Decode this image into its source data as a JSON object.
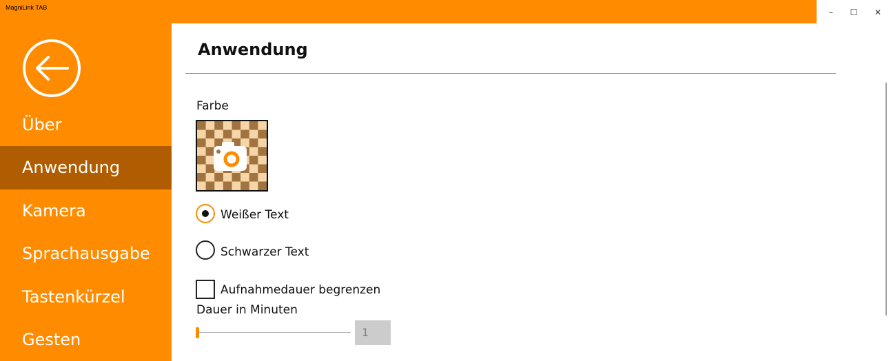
{
  "window": {
    "title": "MagniLink TAB",
    "minimize": "–",
    "maximize": "☐",
    "close": "✕"
  },
  "sidebar": {
    "items": [
      {
        "label": "Über"
      },
      {
        "label": "Anwendung"
      },
      {
        "label": "Kamera"
      },
      {
        "label": "Sprachausgabe"
      },
      {
        "label": "Tastenkürzel"
      },
      {
        "label": "Gesten"
      }
    ]
  },
  "main": {
    "title": "Anwendung",
    "color_label": "Farbe",
    "radio_white": "Weißer Text",
    "radio_black": "Schwarzer Text",
    "checkbox_limit": "Aufnahmedauer begrenzen",
    "duration_label": "Dauer in Minuten",
    "duration_value": "1",
    "duration_level": 0
  },
  "colors": {
    "accent": "#ff8c00",
    "nav_active": "#b05c00",
    "swatch_dark": "#a0733f",
    "swatch_light": "#f6d5a8"
  }
}
